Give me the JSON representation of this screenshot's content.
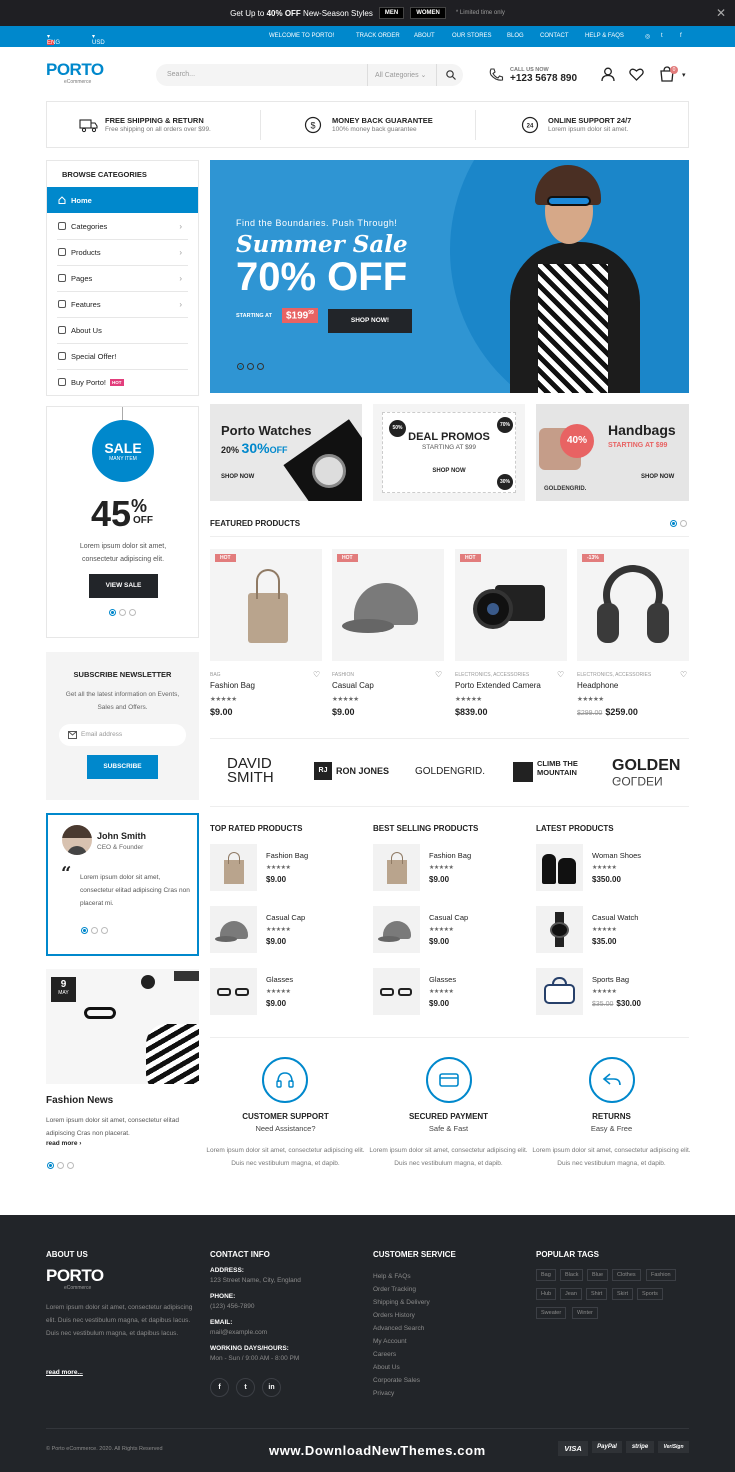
{
  "promo_bar": {
    "text_pre": "Get Up to ",
    "text_bold": "40% OFF",
    "text_post": " New-Season Styles",
    "btn_men": "MEN",
    "btn_women": "WOMEN",
    "note": "* Limited time only",
    "close": "✕"
  },
  "nav": {
    "lang": "ENG",
    "currency": "USD",
    "links": [
      "WELCOME TO PORTO!",
      "TRACK ORDER",
      "ABOUT",
      "OUR STORES",
      "BLOG",
      "CONTACT",
      "HELP & FAQS"
    ]
  },
  "header": {
    "logo": "PORTO",
    "logo_sub": "eCommerce",
    "search_placeholder": "Search...",
    "search_category": "All Categories",
    "call_label": "CALL US NOW",
    "phone": "+123 5678 890",
    "cart_count": "0"
  },
  "features": [
    {
      "title": "FREE SHIPPING & RETURN",
      "sub": "Free shipping on all orders over $99."
    },
    {
      "title": "MONEY BACK GUARANTEE",
      "sub": "100% money back guarantee"
    },
    {
      "title": "ONLINE SUPPORT 24/7",
      "sub": "Lorem ipsum dolor sit amet."
    }
  ],
  "sidebar": {
    "title": "BROWSE CATEGORIES",
    "items": [
      "Home",
      "Categories",
      "Products",
      "Pages",
      "Features",
      "About Us",
      "Special Offer!",
      "Buy Porto!"
    ],
    "hot": "HOT"
  },
  "hero": {
    "kicker": "Find the Boundaries. Push Through!",
    "title": "Summer Sale",
    "big": "70% OFF",
    "starting": "STARTING AT",
    "price": "$199",
    "price_cents": "99",
    "cta": "SHOP NOW!"
  },
  "banners": {
    "watches_title": "Porto Watches",
    "watches_pct1": "20%",
    "watches_pct2": "30%",
    "watches_off": "OFF",
    "watches_cta": "SHOP NOW",
    "promos_title": "DEAL PROMOS",
    "promos_sub": "STARTING AT $99",
    "promos_cta": "SHOP NOW",
    "promos_b1": "50%",
    "promos_b2": "70%",
    "promos_b3": "30%",
    "bags_title": "Handbags",
    "bags_sub": "STARTING AT $99",
    "bags_cta": "SHOP NOW",
    "bags_pct": "40%",
    "bags_brand": "GOLDENGRID."
  },
  "sale_box": {
    "sale": "SALE",
    "many": "MANY ITEM",
    "pct": "45",
    "pct_sign": "%",
    "off": "OFF",
    "text": "Lorem ipsum dolor sit amet, consectetur adipiscing elit.",
    "cta": "VIEW SALE"
  },
  "newsletter": {
    "title": "SUBSCRIBE NEWSLETTER",
    "text": "Get all the latest information on Events, Sales and Offers.",
    "placeholder": "Email address",
    "cta": "SUBSCRIBE"
  },
  "testimonial": {
    "name": "John Smith",
    "role": "CEO & Founder",
    "quote": "Lorem ipsum dolor sit amet, consectetur elitad adipiscing Cras non placerat mi."
  },
  "news": {
    "day": "9",
    "month": "MAY",
    "title": "Fashion News",
    "text": "Lorem ipsum dolor sit amet, consectetur elitad adipiscing Cras non placerat.",
    "more": "read more ›"
  },
  "featured": {
    "title": "FEATURED PRODUCTS",
    "items": [
      {
        "tag": "HOT",
        "cat": "BAG",
        "name": "Fashion Bag",
        "price": "$9.00",
        "old": ""
      },
      {
        "tag": "HOT",
        "cat": "FASHION",
        "name": "Casual Cap",
        "price": "$9.00",
        "old": ""
      },
      {
        "tag": "HOT",
        "cat": "ELECTRONICS, ACCESSORIES",
        "name": "Porto Extended Camera",
        "price": "$839.00",
        "old": ""
      },
      {
        "tag": "-13%",
        "cat": "ELECTRONICS, ACCESSORIES",
        "name": "Headphone",
        "price": "$259.00",
        "old": "$299.00"
      }
    ],
    "stars": "★★★★★"
  },
  "brands": [
    "DAVID SMITH",
    "RJ",
    "RON JONES",
    "GOLDENGRID.",
    "CLIMB THE MOUNTAIN",
    "GOLDEN"
  ],
  "lists": [
    {
      "title": "TOP RATED PRODUCTS",
      "items": [
        {
          "name": "Fashion Bag",
          "price": "$9.00",
          "old": ""
        },
        {
          "name": "Casual Cap",
          "price": "$9.00",
          "old": ""
        },
        {
          "name": "Glasses",
          "price": "$9.00",
          "old": ""
        }
      ]
    },
    {
      "title": "BEST SELLING PRODUCTS",
      "items": [
        {
          "name": "Fashion Bag",
          "price": "$9.00",
          "old": ""
        },
        {
          "name": "Casual Cap",
          "price": "$9.00",
          "old": ""
        },
        {
          "name": "Glasses",
          "price": "$9.00",
          "old": ""
        }
      ]
    },
    {
      "title": "LATEST PRODUCTS",
      "items": [
        {
          "name": "Woman Shoes",
          "price": "$350.00",
          "old": ""
        },
        {
          "name": "Casual Watch",
          "price": "$35.00",
          "old": ""
        },
        {
          "name": "Sports Bag",
          "price": "$30.00",
          "old": "$35.00"
        }
      ]
    }
  ],
  "services": [
    {
      "title": "CUSTOMER SUPPORT",
      "sub": "Need Assistance?",
      "text": "Lorem ipsum dolor sit amet, consectetur adipiscing elit. Duis nec vestibulum magna, et dapib."
    },
    {
      "title": "SECURED PAYMENT",
      "sub": "Safe & Fast",
      "text": "Lorem ipsum dolor sit amet, consectetur adipiscing elit. Duis nec vestibulum magna, et dapib."
    },
    {
      "title": "RETURNS",
      "sub": "Easy & Free",
      "text": "Lorem ipsum dolor sit amet, consectetur adipiscing elit. Duis nec vestibulum magna, et dapib."
    }
  ],
  "footer": {
    "about_title": "ABOUT US",
    "about_text": "Lorem ipsum dolor sit amet, consectetur adipiscing elit. Duis nec vestibulum magna, et dapibus lacus. Duis nec vestibulum magna, et dapibus lacus.",
    "read_more": "read more...",
    "contact_title": "CONTACT INFO",
    "address_label": "ADDRESS:",
    "address": "123 Street Name, City, England",
    "phone_label": "PHONE:",
    "phone": "(123) 456-7890",
    "email_label": "EMAIL:",
    "email": "mail@example.com",
    "hours_label": "WORKING DAYS/HOURS:",
    "hours": "Mon - Sun / 9:00 AM - 8:00 PM",
    "service_title": "CUSTOMER SERVICE",
    "service_links": [
      "Help & FAQs",
      "Order Tracking",
      "Shipping & Delivery",
      "Orders History",
      "Advanced Search",
      "My Account",
      "Careers",
      "About Us",
      "Corporate Sales",
      "Privacy"
    ],
    "tags_title": "POPULAR TAGS",
    "tags": [
      "Bag",
      "Black",
      "Blue",
      "Clothes",
      "Fashion",
      "Hub",
      "Jean",
      "Shirt",
      "Skirt",
      "Sports",
      "Sweater",
      "Winter"
    ],
    "copyright": "© Porto eCommerce. 2020. All Rights Reserved",
    "watermark": "www.DownloadNewThemes.com",
    "payments": [
      "VISA",
      "PayPal",
      "stripe",
      "VeriSign"
    ]
  },
  "colors": {
    "primary": "#0088cc",
    "dark": "#222529",
    "hot": "#e27c7c"
  }
}
